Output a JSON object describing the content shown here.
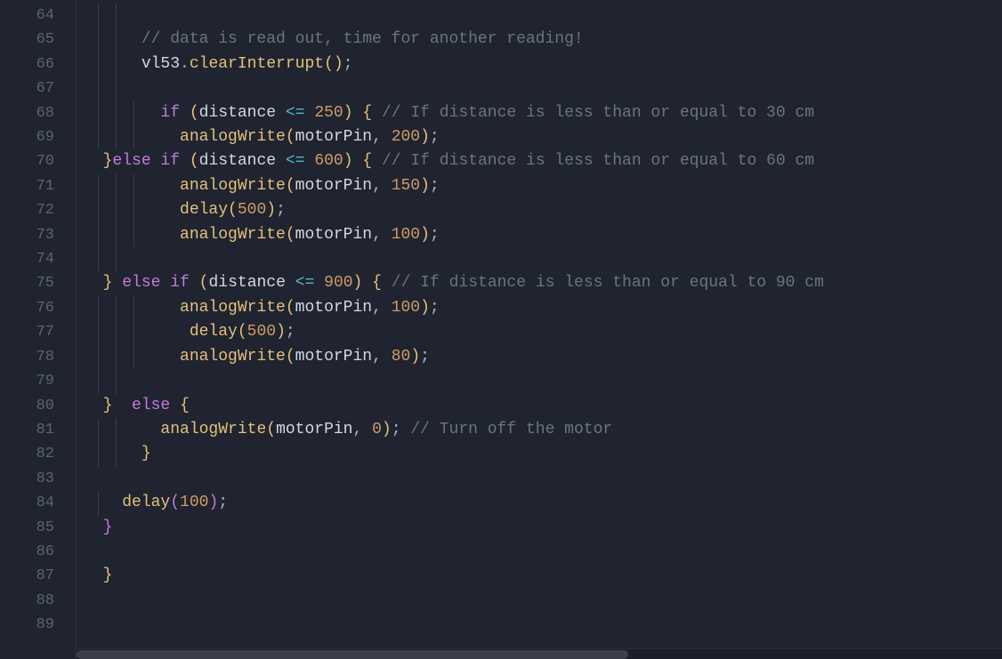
{
  "lineStart": 64,
  "lineEnd": 89,
  "lines": [
    {
      "n": 64,
      "indent": 2,
      "tokens": []
    },
    {
      "n": 65,
      "indent": 2,
      "tokens": [
        {
          "cls": "tok-comment",
          "t": "// data is read out, time for another reading!"
        }
      ]
    },
    {
      "n": 66,
      "indent": 2,
      "tokens": [
        {
          "cls": "tok-ident",
          "t": "vl53"
        },
        {
          "cls": "tok-punc",
          "t": "."
        },
        {
          "cls": "tok-fn",
          "t": "clearInterrupt"
        },
        {
          "cls": "tok-paren-y",
          "t": "()"
        },
        {
          "cls": "tok-punc",
          "t": ";"
        }
      ]
    },
    {
      "n": 67,
      "indent": 2,
      "tokens": []
    },
    {
      "n": 68,
      "indent": 3,
      "tokens": [
        {
          "cls": "tok-kw",
          "t": "if"
        },
        {
          "cls": "",
          "t": " "
        },
        {
          "cls": "tok-paren-y",
          "t": "("
        },
        {
          "cls": "tok-ident",
          "t": "distance"
        },
        {
          "cls": "",
          "t": " "
        },
        {
          "cls": "tok-op",
          "t": "<="
        },
        {
          "cls": "",
          "t": " "
        },
        {
          "cls": "tok-num",
          "t": "250"
        },
        {
          "cls": "tok-paren-y",
          "t": ")"
        },
        {
          "cls": "",
          "t": " "
        },
        {
          "cls": "tok-paren-y",
          "t": "{"
        },
        {
          "cls": "",
          "t": " "
        },
        {
          "cls": "tok-comment",
          "t": "// If distance is less than or equal to 30 cm"
        }
      ]
    },
    {
      "n": 69,
      "indent": 3,
      "tokens": [
        {
          "cls": "",
          "t": "  "
        },
        {
          "cls": "tok-fn",
          "t": "analogWrite"
        },
        {
          "cls": "tok-paren-y",
          "t": "("
        },
        {
          "cls": "tok-ident",
          "t": "motorPin"
        },
        {
          "cls": "tok-punc",
          "t": ", "
        },
        {
          "cls": "tok-num",
          "t": "200"
        },
        {
          "cls": "tok-paren-y",
          "t": ")"
        },
        {
          "cls": "tok-punc",
          "t": ";"
        }
      ]
    },
    {
      "n": 70,
      "indent": 0,
      "tokens": [
        {
          "cls": "tok-paren-y",
          "t": "}"
        },
        {
          "cls": "tok-kw",
          "t": "else if"
        },
        {
          "cls": "",
          "t": " "
        },
        {
          "cls": "tok-paren-y",
          "t": "("
        },
        {
          "cls": "tok-ident",
          "t": "distance"
        },
        {
          "cls": "",
          "t": " "
        },
        {
          "cls": "tok-op",
          "t": "<="
        },
        {
          "cls": "",
          "t": " "
        },
        {
          "cls": "tok-num",
          "t": "600"
        },
        {
          "cls": "tok-paren-y",
          "t": ")"
        },
        {
          "cls": "",
          "t": " "
        },
        {
          "cls": "tok-paren-y",
          "t": "{"
        },
        {
          "cls": "",
          "t": " "
        },
        {
          "cls": "tok-comment",
          "t": "// If distance is less than or equal to 60 cm"
        }
      ]
    },
    {
      "n": 71,
      "indent": 3,
      "tokens": [
        {
          "cls": "",
          "t": "  "
        },
        {
          "cls": "tok-fn",
          "t": "analogWrite"
        },
        {
          "cls": "tok-paren-y",
          "t": "("
        },
        {
          "cls": "tok-ident",
          "t": "motorPin"
        },
        {
          "cls": "tok-punc",
          "t": ", "
        },
        {
          "cls": "tok-num",
          "t": "150"
        },
        {
          "cls": "tok-paren-y",
          "t": ")"
        },
        {
          "cls": "tok-punc",
          "t": ";"
        }
      ]
    },
    {
      "n": 72,
      "indent": 3,
      "tokens": [
        {
          "cls": "",
          "t": "  "
        },
        {
          "cls": "tok-fn",
          "t": "delay"
        },
        {
          "cls": "tok-paren-y",
          "t": "("
        },
        {
          "cls": "tok-num",
          "t": "500"
        },
        {
          "cls": "tok-paren-y",
          "t": ")"
        },
        {
          "cls": "tok-punc",
          "t": ";"
        }
      ]
    },
    {
      "n": 73,
      "indent": 3,
      "tokens": [
        {
          "cls": "",
          "t": "  "
        },
        {
          "cls": "tok-fn",
          "t": "analogWrite"
        },
        {
          "cls": "tok-paren-y",
          "t": "("
        },
        {
          "cls": "tok-ident",
          "t": "motorPin"
        },
        {
          "cls": "tok-punc",
          "t": ", "
        },
        {
          "cls": "tok-num",
          "t": "100"
        },
        {
          "cls": "tok-paren-y",
          "t": ")"
        },
        {
          "cls": "tok-punc",
          "t": ";"
        }
      ]
    },
    {
      "n": 74,
      "indent": 2,
      "tokens": []
    },
    {
      "n": 75,
      "indent": 0,
      "tokens": [
        {
          "cls": "tok-paren-y",
          "t": "}"
        },
        {
          "cls": "",
          "t": " "
        },
        {
          "cls": "tok-kw",
          "t": "else if"
        },
        {
          "cls": "",
          "t": " "
        },
        {
          "cls": "tok-paren-y",
          "t": "("
        },
        {
          "cls": "tok-ident",
          "t": "distance"
        },
        {
          "cls": "",
          "t": " "
        },
        {
          "cls": "tok-op",
          "t": "<="
        },
        {
          "cls": "",
          "t": " "
        },
        {
          "cls": "tok-num",
          "t": "900"
        },
        {
          "cls": "tok-paren-y",
          "t": ")"
        },
        {
          "cls": "",
          "t": " "
        },
        {
          "cls": "tok-paren-y",
          "t": "{"
        },
        {
          "cls": "",
          "t": " "
        },
        {
          "cls": "tok-comment",
          "t": "// If distance is less than or equal to 90 cm"
        }
      ]
    },
    {
      "n": 76,
      "indent": 3,
      "tokens": [
        {
          "cls": "",
          "t": "  "
        },
        {
          "cls": "tok-fn",
          "t": "analogWrite"
        },
        {
          "cls": "tok-paren-y",
          "t": "("
        },
        {
          "cls": "tok-ident",
          "t": "motorPin"
        },
        {
          "cls": "tok-punc",
          "t": ", "
        },
        {
          "cls": "tok-num",
          "t": "100"
        },
        {
          "cls": "tok-paren-y",
          "t": ")"
        },
        {
          "cls": "tok-punc",
          "t": ";"
        }
      ]
    },
    {
      "n": 77,
      "indent": 3,
      "tokens": [
        {
          "cls": "",
          "t": "   "
        },
        {
          "cls": "tok-fn",
          "t": "delay"
        },
        {
          "cls": "tok-paren-y",
          "t": "("
        },
        {
          "cls": "tok-num",
          "t": "500"
        },
        {
          "cls": "tok-paren-y",
          "t": ")"
        },
        {
          "cls": "tok-punc",
          "t": ";"
        }
      ]
    },
    {
      "n": 78,
      "indent": 3,
      "tokens": [
        {
          "cls": "",
          "t": "  "
        },
        {
          "cls": "tok-fn",
          "t": "analogWrite"
        },
        {
          "cls": "tok-paren-y",
          "t": "("
        },
        {
          "cls": "tok-ident",
          "t": "motorPin"
        },
        {
          "cls": "tok-punc",
          "t": ", "
        },
        {
          "cls": "tok-num",
          "t": "80"
        },
        {
          "cls": "tok-paren-y",
          "t": ")"
        },
        {
          "cls": "tok-punc",
          "t": ";"
        }
      ]
    },
    {
      "n": 79,
      "indent": 2,
      "tokens": []
    },
    {
      "n": 80,
      "indent": 0,
      "tokens": [
        {
          "cls": "tok-paren-y",
          "t": "}"
        },
        {
          "cls": "",
          "t": "  "
        },
        {
          "cls": "tok-kw",
          "t": "else"
        },
        {
          "cls": "",
          "t": " "
        },
        {
          "cls": "tok-paren-y",
          "t": "{"
        }
      ]
    },
    {
      "n": 81,
      "indent": 2,
      "tokens": [
        {
          "cls": "",
          "t": "  "
        },
        {
          "cls": "tok-fn",
          "t": "analogWrite"
        },
        {
          "cls": "tok-paren-y",
          "t": "("
        },
        {
          "cls": "tok-ident",
          "t": "motorPin"
        },
        {
          "cls": "tok-punc",
          "t": ", "
        },
        {
          "cls": "tok-num",
          "t": "0"
        },
        {
          "cls": "tok-paren-y",
          "t": ")"
        },
        {
          "cls": "tok-punc",
          "t": ";"
        },
        {
          "cls": "",
          "t": " "
        },
        {
          "cls": "tok-comment",
          "t": "// Turn off the motor"
        }
      ]
    },
    {
      "n": 82,
      "indent": 2,
      "tokens": [
        {
          "cls": "tok-paren-y",
          "t": "}"
        }
      ]
    },
    {
      "n": 83,
      "indent": 0,
      "tokens": []
    },
    {
      "n": 84,
      "indent": 1,
      "tokens": [
        {
          "cls": "tok-fn",
          "t": "delay"
        },
        {
          "cls": "tok-paren-p",
          "t": "("
        },
        {
          "cls": "tok-num",
          "t": "100"
        },
        {
          "cls": "tok-paren-p",
          "t": ")"
        },
        {
          "cls": "tok-punc",
          "t": ";"
        }
      ]
    },
    {
      "n": 85,
      "indent": 0,
      "tokens": [
        {
          "cls": "tok-paren-p",
          "t": "}"
        }
      ]
    },
    {
      "n": 86,
      "indent": 0,
      "tokens": []
    },
    {
      "n": 87,
      "indent": 0,
      "tokens": [
        {
          "cls": "tok-paren-y",
          "t": "}"
        }
      ]
    },
    {
      "n": 88,
      "indent": 0,
      "tokens": []
    },
    {
      "n": 89,
      "indent": 0,
      "tokens": []
    }
  ],
  "indentUnit": "  ",
  "baseIndentOffset": 1
}
